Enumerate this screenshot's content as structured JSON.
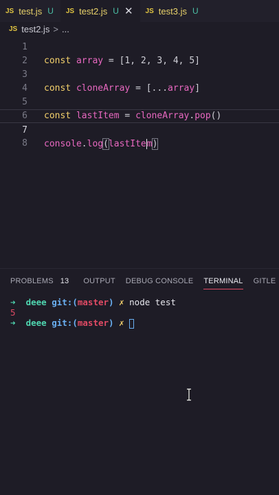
{
  "tabs": [
    {
      "icon": "JS",
      "name": "test.js",
      "status": "U"
    },
    {
      "icon": "JS",
      "name": "test2.js",
      "status": "U",
      "close": "✕"
    },
    {
      "icon": "JS",
      "name": "test3.js",
      "status": "U"
    }
  ],
  "breadcrumb": {
    "icon": "JS",
    "file": "test2.js",
    "sep": ">",
    "more": "..."
  },
  "editor": {
    "lines": [
      {
        "n": "1",
        "kw": "const",
        "name": "array",
        "rest": " = [1, 2, 3, 4, 5]"
      },
      {
        "n": "2"
      },
      {
        "n": "3",
        "kw": "const",
        "name": "cloneArray",
        "op": " = [...",
        "ref": "array",
        "end": "]"
      },
      {
        "n": "4"
      },
      {
        "n": "5",
        "kw": "const",
        "name": "lastItem",
        "op": " = ",
        "ref": "cloneArray",
        "dot": ".",
        "call": "pop",
        "end": "()"
      },
      {
        "n": "6"
      },
      {
        "n": "7",
        "obj": "console",
        "dot": ".",
        "call": "log",
        "open": "(",
        "arg_a": "lastIte",
        "arg_b": "m",
        "close": ")"
      },
      {
        "n": "8"
      }
    ]
  },
  "panel": {
    "tabs": [
      "PROBLEMS",
      "OUTPUT",
      "DEBUG CONSOLE",
      "TERMINAL",
      "GITLE"
    ],
    "problems_count": "13"
  },
  "terminal": {
    "arrow": "➜",
    "dir": "deee",
    "git": "git:(",
    "branch": "master",
    "git_close": ")",
    "x_mark": "✗",
    "command": "node test",
    "output": "5"
  },
  "colors": {
    "accent": "#e04a64",
    "keyword": "#f3d06b",
    "identifier": "#e868c0",
    "prompt": "#4fd6b0"
  }
}
